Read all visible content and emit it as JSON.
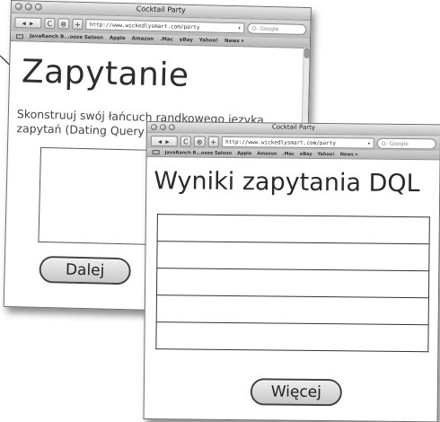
{
  "back_window": {
    "title": "Cocktail Party",
    "url": "http://www.wickedlysmart.com/party",
    "search_placeholder": "Q- Google",
    "nav_label": "◂ ▸",
    "reload_label": "C",
    "add_label": "+",
    "bookmarks": [
      "JavaRanch B...ooze Saloon",
      "Apple",
      "Amazon",
      ".Mac",
      "eBay",
      "Yahoo!",
      "News ▾"
    ],
    "heading": "Zapytanie",
    "description": "Skonstruuj swój łańcuch randkowego języka zapytań (Dating Query",
    "next_button": "Dalej"
  },
  "front_window": {
    "title": "Cocktail Party",
    "url": "http://www.wickedlysmart.com/party",
    "search_placeholder": "Q- Google",
    "nav_label": "◂ ▸",
    "reload_label": "C",
    "add_label": "+",
    "bookmarks": [
      "JavaRanch B...ooze Saloon",
      "Apple",
      "Amazon",
      ".Mac",
      "eBay",
      "Yahoo!",
      "News ▾"
    ],
    "heading": "Wyniki zapytania DQL",
    "result_rows": 5,
    "more_button": "Więcej"
  }
}
